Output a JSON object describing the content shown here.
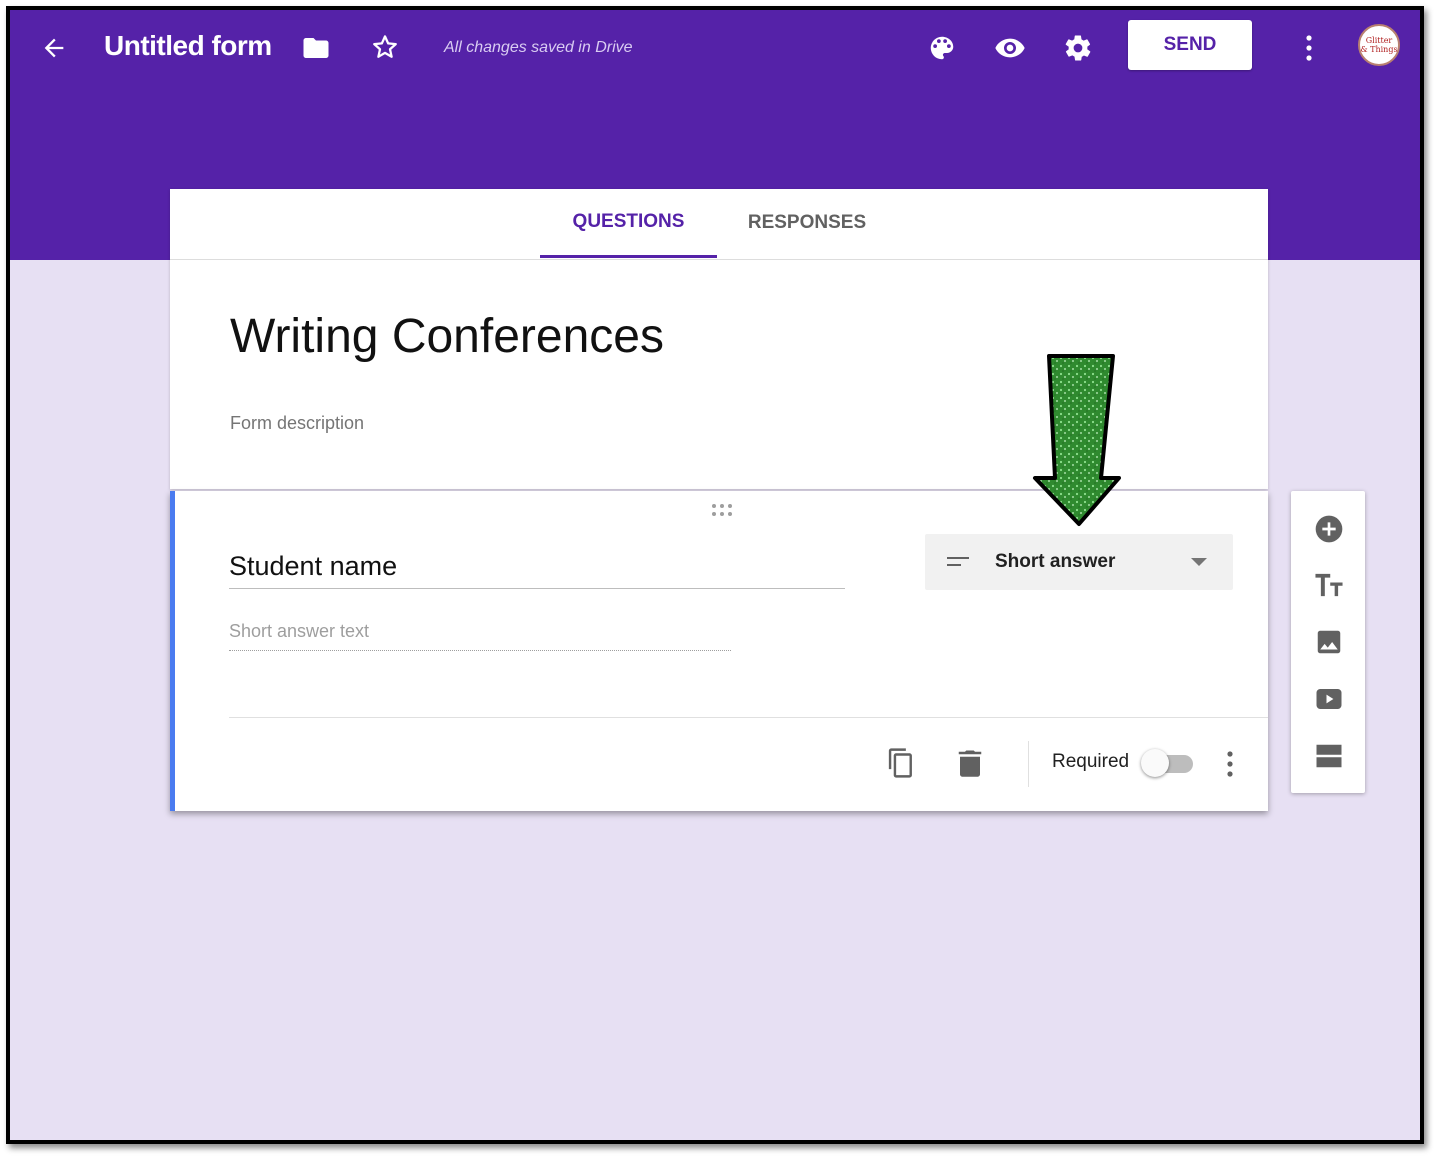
{
  "topbar": {
    "title": "Untitled form",
    "save_status": "All changes saved in Drive",
    "send_label": "SEND",
    "avatar_text": [
      "Glitter",
      "& Things"
    ]
  },
  "tabs": {
    "questions": "QUESTIONS",
    "responses": "RESPONSES"
  },
  "form": {
    "title": "Writing Conferences",
    "description_placeholder": "Form description"
  },
  "question": {
    "title": "Student name",
    "answer_placeholder": "Short answer text",
    "type": "Short answer",
    "required_label": "Required",
    "required": false
  },
  "colors": {
    "primary": "#5522a8",
    "page_background": "#e7e0f3",
    "question_accent": "#4a7bf0",
    "arrow": "#2f8a2f"
  },
  "icons": {
    "toolbar": [
      "back-arrow-icon",
      "folder-icon",
      "star-icon",
      "palette-icon",
      "eye-icon",
      "gear-icon",
      "more-vert-icon"
    ],
    "question_footer": [
      "duplicate-icon",
      "delete-icon",
      "more-vert-icon"
    ],
    "side_toolbar": [
      "add-question-icon",
      "title-text-icon",
      "image-icon",
      "video-icon",
      "section-icon"
    ]
  }
}
